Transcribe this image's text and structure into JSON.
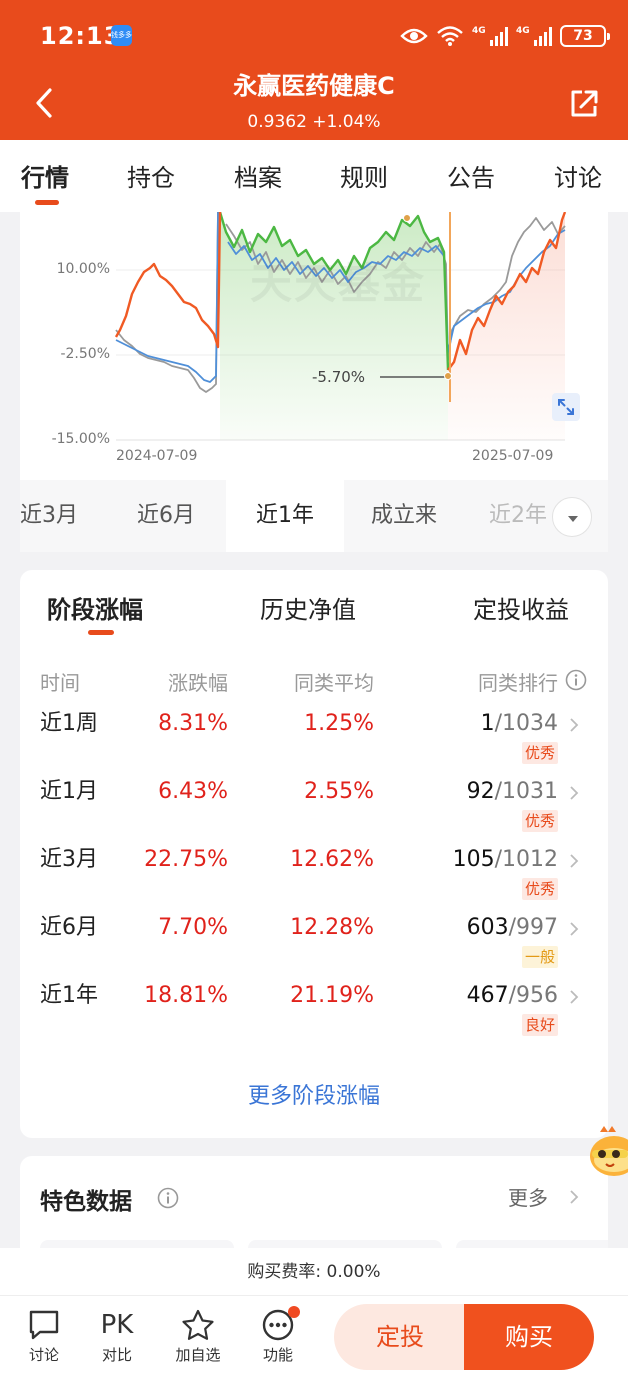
{
  "status_bar": {
    "time": "12:13",
    "app_badge": "钱多多",
    "signal_1": "4G",
    "signal_2": "4G",
    "battery": "73"
  },
  "header": {
    "title": "永赢医药健康C",
    "subtitle": "0.9362 +1.04%"
  },
  "main_tabs": [
    "行情",
    "持仓",
    "档案",
    "规则",
    "公告",
    "讨论"
  ],
  "chart_data": {
    "type": "line",
    "x": [
      "2024-07-09",
      "2025-07-09"
    ],
    "yticks": [
      "10.00%",
      "-2.50%",
      "-15.00%"
    ],
    "ylim": [
      -15,
      22.5
    ],
    "annotation": "-5.70%",
    "watermark": "天天基金",
    "colors": {
      "fund": "#f05a24",
      "fund_hold": "#55b84a",
      "avg": "#4a8fd6",
      "hs300": "#8e8e8e"
    }
  },
  "range_tabs": [
    "近3月",
    "近6月",
    "近1年",
    "成立来",
    "近2年"
  ],
  "perf": {
    "tabs": [
      "阶段涨幅",
      "历史净值",
      "定投收益"
    ],
    "headers": [
      "时间",
      "涨跌幅",
      "同类平均",
      "同类排行"
    ],
    "rows": [
      {
        "period": "近1周",
        "change": "8.31%",
        "avg": "1.25%",
        "rank": "1",
        "total": "/1034",
        "level": "优秀"
      },
      {
        "period": "近1月",
        "change": "6.43%",
        "avg": "2.55%",
        "rank": "92",
        "total": "/1031",
        "level": "优秀"
      },
      {
        "period": "近3月",
        "change": "22.75%",
        "avg": "12.62%",
        "rank": "105",
        "total": "/1012",
        "level": "优秀"
      },
      {
        "period": "近6月",
        "change": "7.70%",
        "avg": "12.28%",
        "rank": "603",
        "total": "/997",
        "level": "一般"
      },
      {
        "period": "近1年",
        "change": "18.81%",
        "avg": "21.19%",
        "rank": "467",
        "total": "/956",
        "level": "良好"
      }
    ],
    "more": "更多阶段涨幅"
  },
  "features": {
    "title": "特色数据",
    "more": "更多"
  },
  "fee": "购买费率: 0.00%",
  "bottom_bar": {
    "discuss": "讨论",
    "compare_icon": "PK",
    "compare": "对比",
    "watch": "加自选",
    "functions": "功能",
    "invest": "定投",
    "buy": "购买"
  }
}
